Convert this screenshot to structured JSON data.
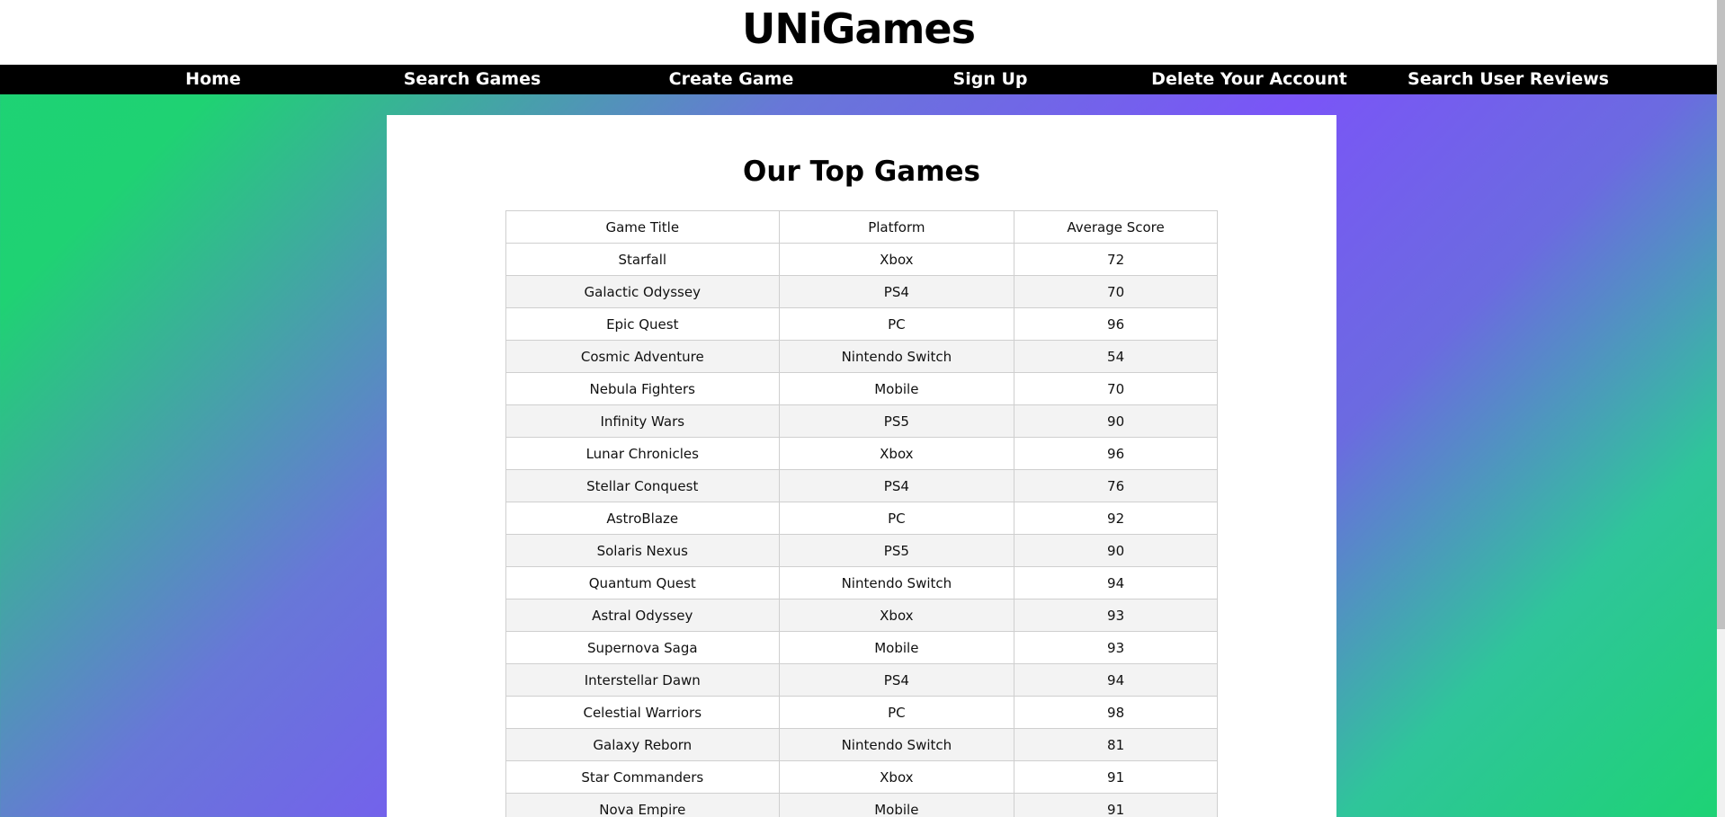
{
  "site": {
    "title": "UNiGames"
  },
  "nav": {
    "items": [
      {
        "label": "Home"
      },
      {
        "label": "Search Games"
      },
      {
        "label": "Create Game"
      },
      {
        "label": "Sign Up"
      },
      {
        "label": "Delete Your Account"
      },
      {
        "label": "Search User Reviews"
      }
    ]
  },
  "main": {
    "heading": "Our Top Games",
    "table": {
      "columns": [
        "Game Title",
        "Platform",
        "Average Score"
      ],
      "rows": [
        [
          "Starfall",
          "Xbox",
          "72"
        ],
        [
          "Galactic Odyssey",
          "PS4",
          "70"
        ],
        [
          "Epic Quest",
          "PC",
          "96"
        ],
        [
          "Cosmic Adventure",
          "Nintendo Switch",
          "54"
        ],
        [
          "Nebula Fighters",
          "Mobile",
          "70"
        ],
        [
          "Infinity Wars",
          "PS5",
          "90"
        ],
        [
          "Lunar Chronicles",
          "Xbox",
          "96"
        ],
        [
          "Stellar Conquest",
          "PS4",
          "76"
        ],
        [
          "AstroBlaze",
          "PC",
          "92"
        ],
        [
          "Solaris Nexus",
          "PS5",
          "90"
        ],
        [
          "Quantum Quest",
          "Nintendo Switch",
          "94"
        ],
        [
          "Astral Odyssey",
          "Xbox",
          "93"
        ],
        [
          "Supernova Saga",
          "Mobile",
          "93"
        ],
        [
          "Interstellar Dawn",
          "PS4",
          "94"
        ],
        [
          "Celestial Warriors",
          "PC",
          "98"
        ],
        [
          "Galaxy Reborn",
          "Nintendo Switch",
          "81"
        ],
        [
          "Star Commanders",
          "Xbox",
          "91"
        ],
        [
          "Nova Empire",
          "Mobile",
          "91"
        ]
      ]
    }
  },
  "colors": {
    "background_gradient": [
      "#1dd374",
      "#7a55f7"
    ],
    "nav_bg": "#000000",
    "nav_text": "#ffffff",
    "row_stripe": "#f3f3f3"
  }
}
